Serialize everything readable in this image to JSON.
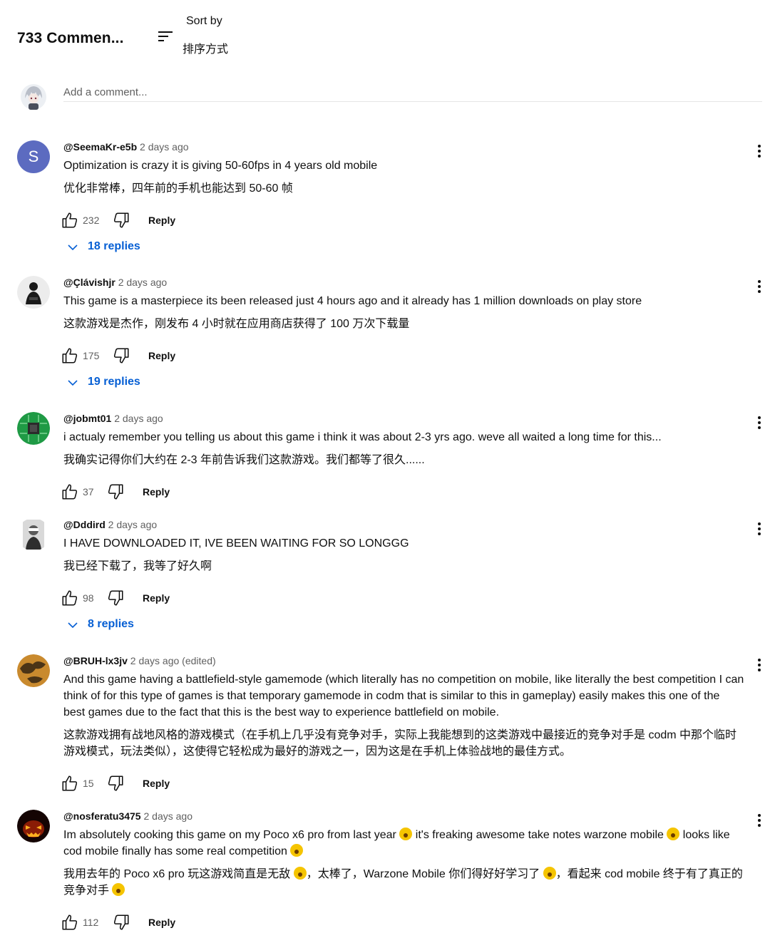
{
  "header": {
    "count": "733 Commen...",
    "sort_label": "Sort by",
    "sort_translation": "排序方式"
  },
  "add_comment": {
    "placeholder": "Add a comment..."
  },
  "comments": [
    {
      "author": "@SeemaKr-e5b",
      "time": "2 days ago",
      "avatar_letter": "S",
      "text": "Optimization is crazy it is giving 50-60fps in 4 years old mobile",
      "translation": "优化非常棒，四年前的手机也能达到 50-60 帧",
      "likes": "232",
      "reply_label": "Reply",
      "replies": "18 replies"
    },
    {
      "author": "@Çlávishjr",
      "time": "2 days ago",
      "text": "This game is a masterpiece its been released just 4 hours ago and it already has 1 million downloads on play store",
      "translation": "这款游戏是杰作，刚发布 4 小时就在应用商店获得了 100 万次下载量",
      "likes": "175",
      "reply_label": "Reply",
      "replies": "19 replies"
    },
    {
      "author": "@jobmt01",
      "time": "2 days ago",
      "text": "i actualy remember you telling us about this game i think it was about 2-3 yrs ago. weve all waited a long time for this...",
      "translation": "我确实记得你们大约在 2-3 年前告诉我们这款游戏。我们都等了很久......",
      "likes": "37",
      "reply_label": "Reply"
    },
    {
      "author": "@Dddird",
      "time": "2 days ago",
      "text": "I HAVE DOWNLOADED IT, IVE BEEN WAITING FOR SO LONGGG",
      "translation": "我已经下载了，我等了好久啊",
      "likes": "98",
      "reply_label": "Reply",
      "replies": "8 replies"
    },
    {
      "author": "@BRUH-lx3jv",
      "time": "2 days ago (edited)",
      "text": "And this game having a battlefield-style gamemode (which literally has no competition on mobile, like literally the best competition I can think of for this type of games is that temporary gamemode in codm that is similar to this in gameplay) easily makes this one of the best games due to the fact that this is the best way to experience battlefield on mobile.",
      "translation": "这款游戏拥有战地风格的游戏模式（在手机上几乎没有竞争对手，实际上我能想到的这类游戏中最接近的竞争对手是 codm 中那个临时游戏模式，玩法类似），这使得它轻松成为最好的游戏之一，因为这是在手机上体验战地的最佳方式。",
      "likes": "15",
      "reply_label": "Reply"
    },
    {
      "author": "@nosferatu3475",
      "time": "2 days ago",
      "text_parts": [
        "Im absolutely cooking this game on my Poco x6 pro from last year ",
        " it's freaking awesome take notes warzone mobile ",
        " looks like cod mobile finally has some real competition "
      ],
      "translation_parts": [
        "我用去年的 Poco x6 pro 玩这游戏简直是无敌 ",
        "，太棒了，Warzone Mobile 你们得好好学习了 ",
        "，看起来 cod mobile 终于有了真正的竞争对手 "
      ],
      "emoji_icons": [
        "astonished-face-icon",
        "laughing-face-icon",
        "exploding-head-icon"
      ],
      "likes": "112",
      "reply_label": "Reply"
    }
  ],
  "colors": {
    "link_blue": "#065fd4",
    "meta_gray": "#606060",
    "avatar_s_bg": "#5c6bc0"
  }
}
